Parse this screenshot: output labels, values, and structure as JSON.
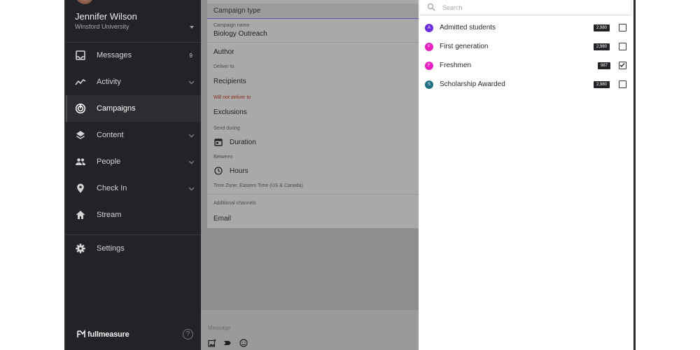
{
  "user": {
    "name": "Jennifer Wilson",
    "org": "Winsford University"
  },
  "nav": {
    "items": [
      {
        "label": "Messages",
        "icon": "inbox-icon",
        "badge": "9"
      },
      {
        "label": "Activity",
        "icon": "activity-icon",
        "expandable": true
      },
      {
        "label": "Campaigns",
        "icon": "campaigns-icon",
        "active": true
      },
      {
        "label": "Content",
        "icon": "layers-icon",
        "expandable": true
      },
      {
        "label": "People",
        "icon": "people-icon",
        "expandable": true
      },
      {
        "label": "Check In",
        "icon": "location-pin-icon",
        "expandable": true
      },
      {
        "label": "Stream",
        "icon": "home-icon"
      }
    ],
    "settings_label": "Settings"
  },
  "brand": {
    "name": "fullmeasure",
    "help_glyph": "?"
  },
  "form": {
    "header": "Campaign type",
    "campaign_name_label": "Campaign name",
    "campaign_name_value": "Biology Outreach",
    "author": "Author",
    "deliver_to_label": "Deliver to",
    "recipients": "Recipients",
    "not_deliver_label": "Will not deliver to",
    "exclusions": "Exclusions",
    "send_during_label": "Send during",
    "duration": "Duration",
    "between_label": "Between",
    "hours": "Hours",
    "timezone": "Time Zone: Eastern Time (US & Canada)",
    "additional_channels_label": "Additional channels",
    "email": "Email"
  },
  "composer": {
    "placeholder": "Message"
  },
  "audience_panel": {
    "search_placeholder": "Search",
    "items": [
      {
        "initial": "A",
        "label": "Admitted students",
        "count": "2,980",
        "checked": false,
        "color": "#6d2ee0"
      },
      {
        "initial": "F",
        "label": "First generation",
        "count": "2,980",
        "checked": false,
        "color": "#e81fbe"
      },
      {
        "initial": "F",
        "label": "Freshmen",
        "count": "987",
        "checked": true,
        "color": "#e81fbe"
      },
      {
        "initial": "S",
        "label": "Scholarship Awarded",
        "count": "2,980",
        "checked": false,
        "color": "#1e6f86"
      }
    ]
  },
  "colors": {
    "sidebar_bg": "#222326",
    "accent_underline": "#6a52b6",
    "badge_bg": "#232427"
  }
}
